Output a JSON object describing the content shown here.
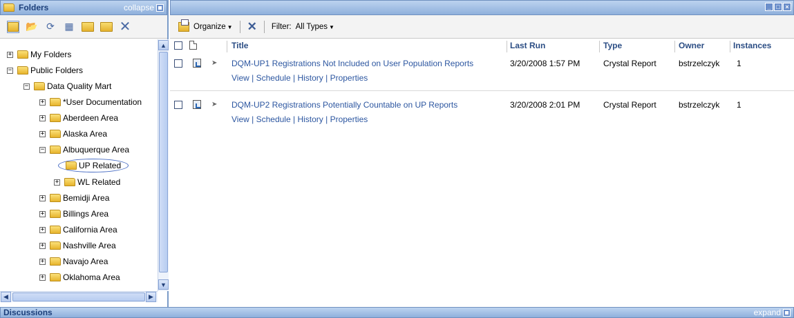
{
  "left_panel": {
    "title": "Folders",
    "collapse_label": "collapse",
    "tree": [
      {
        "label": "My Folders",
        "toggle": "+",
        "depth": 0
      },
      {
        "label": "Public Folders",
        "toggle": "−",
        "depth": 0
      },
      {
        "label": "Data Quality Mart",
        "toggle": "−",
        "depth": 1
      },
      {
        "label": "*User Documentation",
        "toggle": "+",
        "depth": 2
      },
      {
        "label": "Aberdeen Area",
        "toggle": "+",
        "depth": 2
      },
      {
        "label": "Alaska Area",
        "toggle": "+",
        "depth": 2
      },
      {
        "label": "Albuquerque Area",
        "toggle": "−",
        "depth": 2
      },
      {
        "label": "UP Related",
        "toggle": "",
        "depth": 3,
        "selected": true
      },
      {
        "label": "WL Related",
        "toggle": "+",
        "depth": 3
      },
      {
        "label": "Bemidji Area",
        "toggle": "+",
        "depth": 2
      },
      {
        "label": "Billings Area",
        "toggle": "+",
        "depth": 2
      },
      {
        "label": "California Area",
        "toggle": "+",
        "depth": 2
      },
      {
        "label": "Nashville Area",
        "toggle": "+",
        "depth": 2
      },
      {
        "label": "Navajo Area",
        "toggle": "+",
        "depth": 2
      },
      {
        "label": "Oklahoma Area",
        "toggle": "+",
        "depth": 2
      }
    ]
  },
  "toolbar": {
    "organize_label": "Organize",
    "filter_label": "Filter:",
    "filter_value": "All Types"
  },
  "table": {
    "columns": [
      "Title",
      "Last Run",
      "Type",
      "Owner",
      "Instances"
    ],
    "rows": [
      {
        "title": "DQM-UP1 Registrations Not Included on User Population Reports",
        "last_run": "3/20/2008 1:57 PM",
        "type": "Crystal Report",
        "owner": "bstrzelczyk",
        "instances": "1",
        "actions": [
          "View",
          "Schedule",
          "History",
          "Properties"
        ]
      },
      {
        "title": "DQM-UP2 Registrations Potentially Countable on UP Reports",
        "last_run": "3/20/2008 2:01 PM",
        "type": "Crystal Report",
        "owner": "bstrzelczyk",
        "instances": "1",
        "actions": [
          "View",
          "Schedule",
          "History",
          "Properties"
        ]
      }
    ]
  },
  "bottom_panel": {
    "title": "Discussions",
    "expand_label": "expand"
  }
}
